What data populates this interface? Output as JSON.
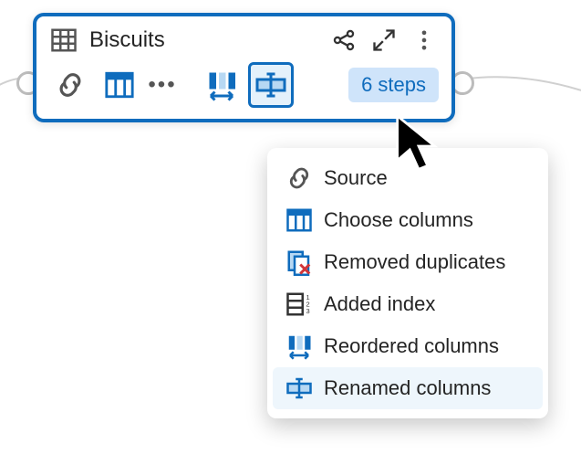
{
  "node": {
    "title": "Biscuits",
    "steps_badge": "6 steps"
  },
  "icons": {
    "table": "table-icon",
    "lineage": "lineage-icon",
    "expand": "expand-icon",
    "more": "more-icon",
    "source": "source-icon",
    "choose_columns": "choose-columns-icon",
    "ellipsis": "ellipsis-icon",
    "reorder": "reorder-columns-icon",
    "rename": "rename-columns-icon",
    "removed_dup": "removed-duplicates-icon",
    "added_index": "added-index-icon"
  },
  "popover": {
    "items": [
      {
        "label": "Source",
        "icon": "source-icon",
        "highlighted": false
      },
      {
        "label": "Choose columns",
        "icon": "choose-columns-icon",
        "highlighted": false
      },
      {
        "label": "Removed duplicates",
        "icon": "removed-duplicates-icon",
        "highlighted": false
      },
      {
        "label": "Added index",
        "icon": "added-index-icon",
        "highlighted": false
      },
      {
        "label": "Reordered columns",
        "icon": "reorder-columns-icon",
        "highlighted": false
      },
      {
        "label": "Renamed columns",
        "icon": "rename-columns-icon",
        "highlighted": true
      }
    ]
  },
  "colors": {
    "accent": "#0f6cbd",
    "badge_bg": "#cfe4fa",
    "highlight_bg": "#eef6fc",
    "danger": "#d13438"
  }
}
